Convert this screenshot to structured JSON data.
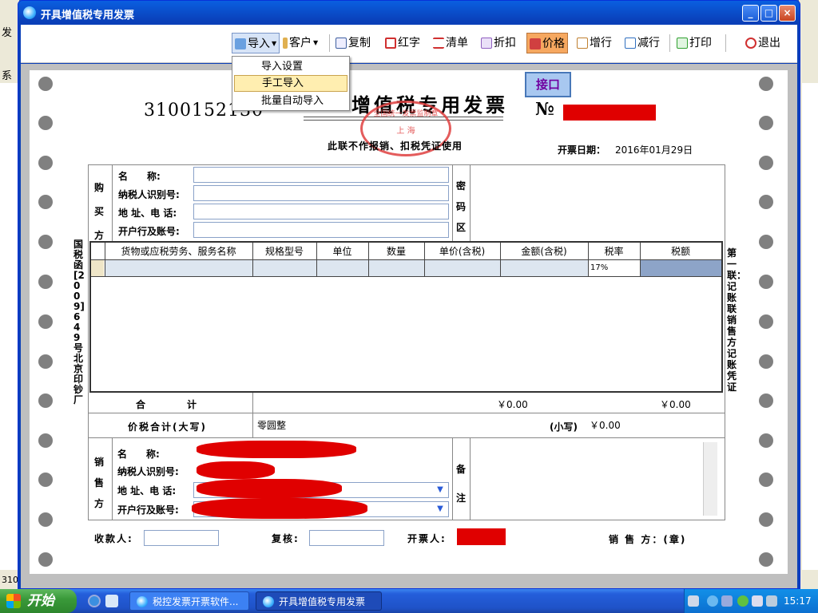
{
  "background_app": {
    "left_fragment_1": "发",
    "left_fragment_2": "系",
    "left_fragment_3": "310"
  },
  "window": {
    "title": "开具增值税专用发票",
    "minimize": "_",
    "maximize": "□",
    "close": "×"
  },
  "toolbar": {
    "import": "导入",
    "customer": "客户",
    "copy": "复制",
    "red_invoice": "红字",
    "list": "清单",
    "discount": "折扣",
    "price": "价格",
    "add_row": "增行",
    "remove_row": "减行",
    "print": "打印",
    "exit": "退出"
  },
  "import_menu": {
    "items": [
      "导入设置",
      "手工导入",
      "批量自动导入"
    ]
  },
  "interface_button": "接口",
  "invoice": {
    "code": "3100152130",
    "title": "增值税专用发票",
    "no_label": "№",
    "stamp_top": "全国统一发票监制章",
    "stamp_mid": "上 海",
    "stamp_bottom": "国家税务总局监制",
    "notice": "此联不作报销、扣税凭证使用",
    "date_label": "开票日期：",
    "date_value": "2016年01月29日",
    "side_left": "国税函[2009]649号北京印钞厂",
    "side_right": "第一联：记账联 销售方记账凭证",
    "buyer": {
      "section": "购买方",
      "name_label": "名　　称:",
      "taxid_label": "纳税人识别号:",
      "address_label": "地 址、电 话:",
      "bank_label": "开户行及账号:",
      "name": "",
      "taxid": "",
      "address": "",
      "bank": ""
    },
    "password_area": "密码区",
    "items_table": {
      "headers": [
        "货物或应税劳务、服务名称",
        "规格型号",
        "单位",
        "数量",
        "单价(含税)",
        "金额(含税)",
        "税率",
        "税额"
      ],
      "row": [
        "",
        "",
        "",
        "",
        "",
        "",
        "17%",
        ""
      ]
    },
    "total_label": "合　　　计",
    "total_amount": "￥0.00",
    "total_tax": "￥0.00",
    "sum_label": "价税合计(大写)",
    "sum_upper": "零圆整",
    "sum_lower_label": "(小写)",
    "sum_lower": "￥0.00",
    "seller": {
      "section": "销售方",
      "name_label": "名　　称:",
      "taxid_label": "纳税人识别号:",
      "address_label": "地 址、电 话:",
      "bank_label": "开户行及账号:"
    },
    "remark": "备注",
    "payee_label": "收款人:",
    "reviewer_label": "复核:",
    "issuer_label": "开票人:",
    "seller_seal_label": "销 售 方：(章)"
  },
  "taskbar": {
    "start": "开始",
    "task1": "税控发票开票软件...",
    "task2": "开具增值税专用发票",
    "clock": "15:17"
  },
  "colors": {
    "redaction": "#e00000",
    "price_button": "#f6a860",
    "interface_text": "#7000a0"
  }
}
